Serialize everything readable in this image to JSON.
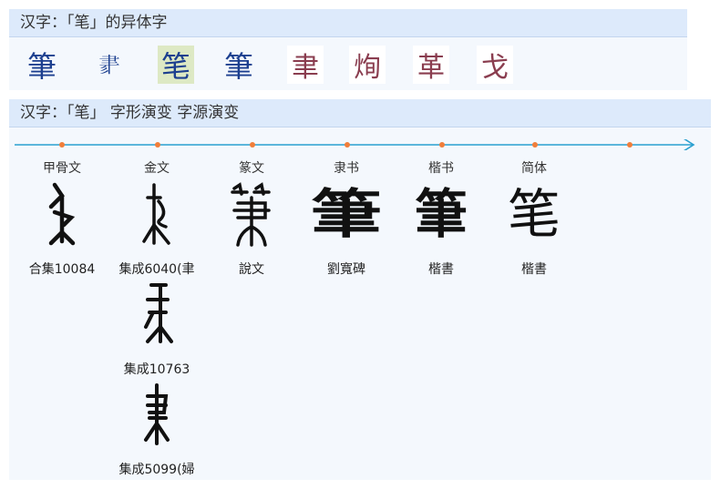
{
  "variants_panel": {
    "title": "汉字：「",
    "char": "笔",
    "title_end": "」的异体字",
    "items": [
      "筆",
      "𦘔",
      "笔",
      "筆",
      "聿",
      "㶷",
      "革",
      "戈"
    ]
  },
  "evolution_panel": {
    "title": "汉字：「笔」 字形演变 字源演变",
    "eras": [
      "甲骨文",
      "金文",
      "篆文",
      "隶书",
      "楷书",
      "简体"
    ],
    "columns": [
      {
        "era": "甲骨文",
        "items": [
          {
            "source": "合集10084"
          }
        ]
      },
      {
        "era": "金文",
        "items": [
          {
            "source": "集成6040(聿"
          },
          {
            "source": "集成10763"
          },
          {
            "source": "集成5099(婦"
          }
        ]
      },
      {
        "era": "篆文",
        "items": [
          {
            "source": "說文"
          }
        ]
      },
      {
        "era": "隶书",
        "items": [
          {
            "glyph": "筆",
            "source": "劉寬碑"
          }
        ]
      },
      {
        "era": "楷书",
        "items": [
          {
            "glyph": "筆",
            "source": "楷書"
          }
        ]
      },
      {
        "era": "简体",
        "items": [
          {
            "glyph": "笔",
            "source": "楷書"
          }
        ]
      }
    ]
  },
  "colors": {
    "accent": "#2aa0d0",
    "dot": "#f07e3a",
    "header_bg": "#ddeafb",
    "panel_bg": "#f4f8fd"
  }
}
